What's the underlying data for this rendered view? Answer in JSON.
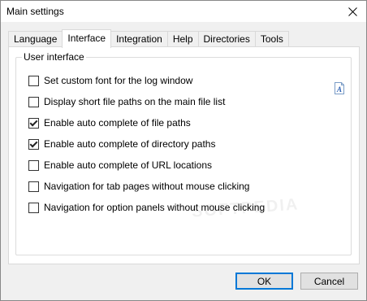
{
  "window": {
    "title": "Main settings"
  },
  "tabs": [
    {
      "label": "Language",
      "active": false
    },
    {
      "label": "Interface",
      "active": true
    },
    {
      "label": "Integration",
      "active": false
    },
    {
      "label": "Help",
      "active": false
    },
    {
      "label": "Directories",
      "active": false
    },
    {
      "label": "Tools",
      "active": false
    }
  ],
  "group": {
    "label": "User interface",
    "options": [
      {
        "label": "Set custom font for the log window",
        "checked": false
      },
      {
        "label": "Display short file paths on the main file list",
        "checked": false
      },
      {
        "label": "Enable auto complete of file paths",
        "checked": true
      },
      {
        "label": "Enable auto complete of directory paths",
        "checked": true
      },
      {
        "label": "Enable auto complete of URL locations",
        "checked": false
      },
      {
        "label": "Navigation for tab pages without mouse clicking",
        "checked": false
      },
      {
        "label": "Navigation for option panels without mouse clicking",
        "checked": false
      }
    ]
  },
  "watermark": "SOFTPEDIA",
  "buttons": {
    "ok": "OK",
    "cancel": "Cancel"
  },
  "icons": {
    "close": "close-icon",
    "font": "font-icon"
  },
  "colors": {
    "default_button_border": "#0078d7",
    "panel_bg": "#ffffff",
    "window_bg": "#f0f0f0"
  }
}
